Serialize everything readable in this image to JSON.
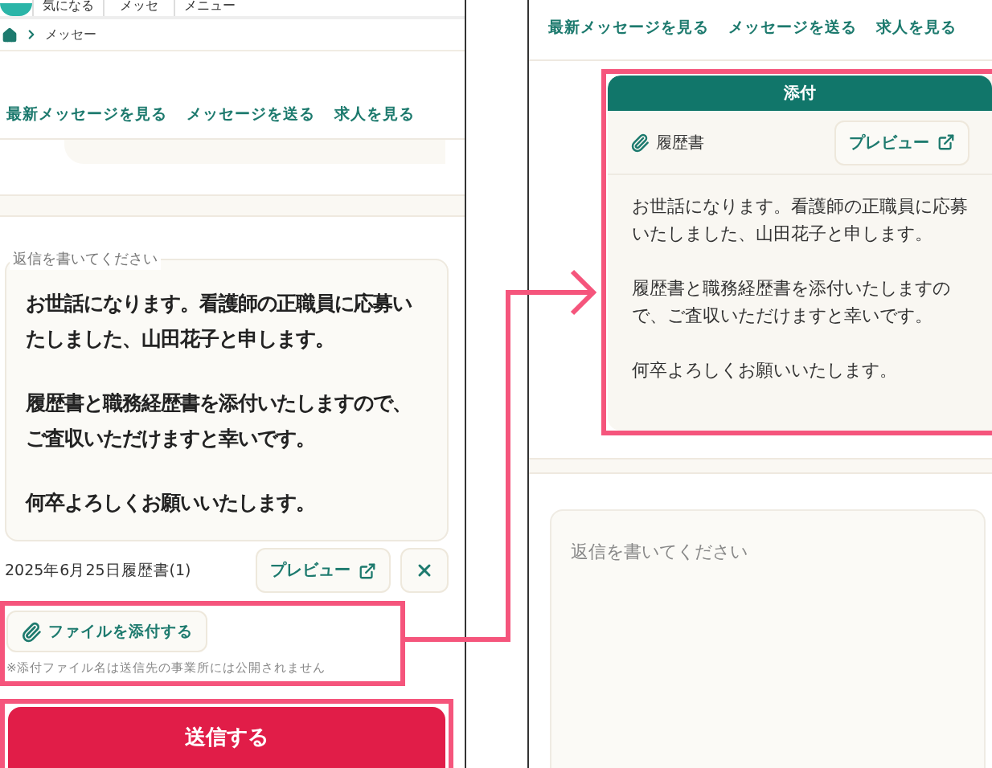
{
  "left_screen": {
    "header_nav": [
      "気になる",
      "メッセ",
      "メニュー"
    ],
    "breadcrumb": "メッセー",
    "nav_links": [
      "最新メッセージを見る",
      "メッセージを送る",
      "求人を見る"
    ],
    "reply_field": {
      "label": "返信を書いてください",
      "paragraphs": [
        "お世話になります。看護師の正職員に応募いたしました、山田花子と申します。",
        "履歴書と職務経歴書を添付いたしますので、ご査収いただけますと幸いです。",
        "何卒よろしくお願いいたします。"
      ]
    },
    "attachment": {
      "file_name": "2025年6月25日履歴書(1)",
      "preview_button": "プレビュー"
    },
    "attach_button": "ファイルを添付する",
    "note": "※添付ファイル名は送信先の事業所には公開されません",
    "send_button": "送信する"
  },
  "right_screen": {
    "nav_links": [
      "最新メッセージを見る",
      "メッセージを送る",
      "求人を見る"
    ],
    "attachment_card": {
      "title": "添付",
      "file_name": "履歴書",
      "preview_button": "プレビュー",
      "message_paragraphs": [
        "お世話になります。看護師の正職員に応募いたしました、山田花子と申します。",
        "履歴書と職務経歴書を添付いたしますので、ご査収いただけますと幸いです。",
        "何卒よろしくお願いいたします。"
      ]
    },
    "reply_field": {
      "placeholder": "返信を書いてください"
    }
  }
}
